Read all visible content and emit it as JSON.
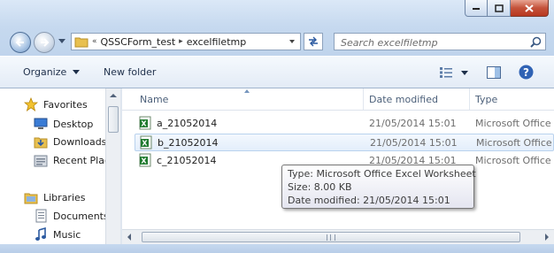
{
  "address": {
    "overflow": "«",
    "breadcrumbs": [
      "QSSCForm_test",
      "excelfiletmp"
    ]
  },
  "search": {
    "placeholder": "Search excelfiletmp"
  },
  "toolbar": {
    "organize_label": "Organize",
    "new_folder_label": "New folder"
  },
  "nav": {
    "favorites_label": "Favorites",
    "favorites": [
      "Desktop",
      "Downloads",
      "Recent Plac"
    ],
    "libraries_label": "Libraries",
    "libraries": [
      "Documents",
      "Music"
    ]
  },
  "columns": {
    "name": "Name",
    "date": "Date modified",
    "type": "Type"
  },
  "files": [
    {
      "name": "a_21052014",
      "date": "21/05/2014 15:01",
      "type": "Microsoft Office"
    },
    {
      "name": "b_21052014",
      "date": "21/05/2014 15:01",
      "type": "Microsoft Office"
    },
    {
      "name": "c_21052014",
      "date": "21/05/2014 15:01",
      "type": "Microsoft Office"
    }
  ],
  "tooltip": {
    "type_line": "Type: Microsoft Office Excel Worksheet",
    "size_line": "Size: 8.00 KB",
    "date_line": "Date modified: 21/05/2014 15:01"
  },
  "colors": {
    "accent": "#2c5aa0",
    "close_button": "#c4523a",
    "excel_green": "#1f7a2e",
    "folder_yellow": "#e8c04f"
  },
  "icons": [
    "minimize-icon",
    "maximize-icon",
    "close-icon",
    "back-arrow-icon",
    "forward-arrow-icon",
    "folder-icon",
    "refresh-icon",
    "search-icon",
    "view-options-icon",
    "preview-pane-icon",
    "help-icon",
    "star-icon",
    "desktop-icon",
    "downloads-icon",
    "recent-places-icon",
    "libraries-icon",
    "documents-icon",
    "music-icon",
    "excel-file-icon"
  ]
}
